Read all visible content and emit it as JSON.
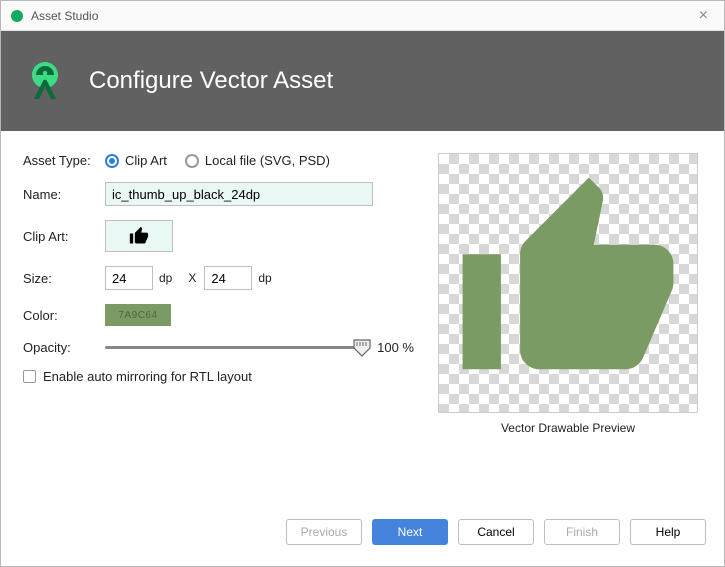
{
  "window": {
    "title": "Asset Studio"
  },
  "header": {
    "title": "Configure Vector Asset"
  },
  "form": {
    "asset_type_label": "Asset Type:",
    "radio_clipart": "Clip Art",
    "radio_local": "Local file (SVG, PSD)",
    "name_label": "Name:",
    "name_value": "ic_thumb_up_black_24dp",
    "clipart_label": "Clip Art:",
    "size_label": "Size:",
    "size_w": "24",
    "size_h": "24",
    "size_unit": "dp",
    "size_x": "X",
    "color_label": "Color:",
    "color_hex": "7A9C64",
    "opacity_label": "Opacity:",
    "opacity_value": "100 %",
    "checkbox_label": "Enable auto mirroring for RTL layout"
  },
  "preview": {
    "label": "Vector Drawable Preview"
  },
  "footer": {
    "previous": "Previous",
    "next": "Next",
    "cancel": "Cancel",
    "finish": "Finish",
    "help": "Help"
  },
  "colors": {
    "accent": "#7a9c64",
    "primary_btn": "#4484dd"
  }
}
